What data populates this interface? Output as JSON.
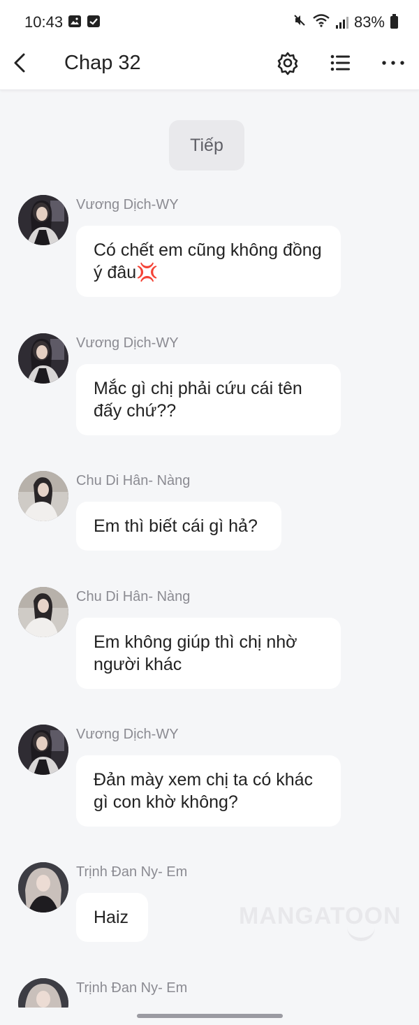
{
  "status_bar": {
    "time": "10:43",
    "battery": "83%",
    "icons": [
      "gallery-icon",
      "checkbox-icon",
      "mute-icon",
      "wifi-icon",
      "signal-icon",
      "battery-icon"
    ]
  },
  "app_bar": {
    "title": "Chap 32",
    "icons": [
      "back-arrow-icon",
      "gear-icon",
      "list-icon",
      "more-icon"
    ]
  },
  "next_label": "Tiếp",
  "messages": [
    {
      "sender": "Vương Dịch-WY",
      "text": "Có chết em cũng không đồng ý đâu💢"
    },
    {
      "sender": "Vương Dịch-WY",
      "text": "Mắc gì chị phải cứu cái tên đấy chứ??"
    },
    {
      "sender": "Chu Di Hân- Nàng",
      "text": "Em thì biết cái gì hả?"
    },
    {
      "sender": "Chu Di Hân- Nàng",
      "text": "Em không giúp thì chị nhờ người khác"
    },
    {
      "sender": "Vương Dịch-WY",
      "text": "Đản mày xem chị ta có khác gì con khờ không?"
    },
    {
      "sender": "Trịnh Đan Ny- Em",
      "text": "Haiz"
    },
    {
      "sender": "Trịnh Đan Ny- Em",
      "text": ""
    }
  ],
  "watermark": "MANGATOON",
  "colors": {
    "background": "#f5f6f8",
    "bubble": "#ffffff",
    "sender_text": "#8b8b92",
    "next_button_bg": "#e9e9ec"
  }
}
